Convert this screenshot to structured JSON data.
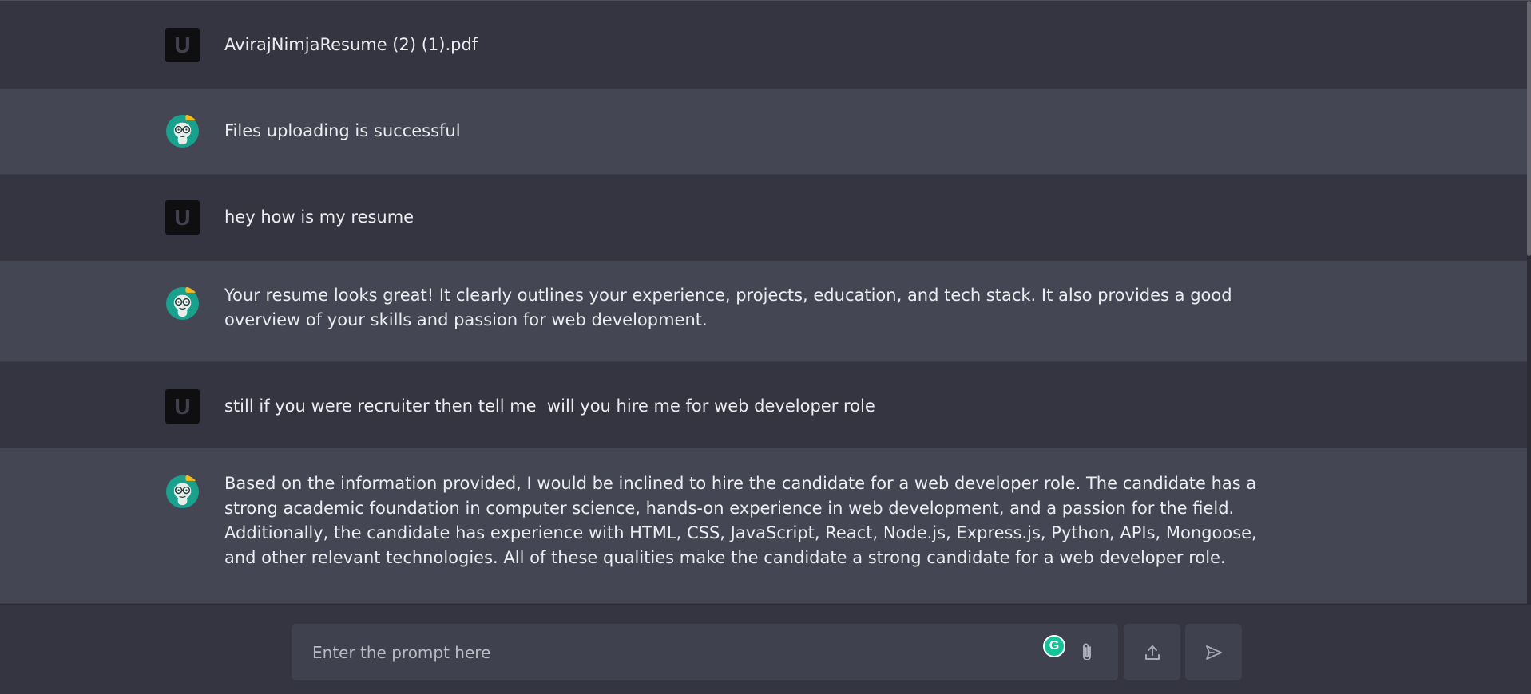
{
  "messages": [
    {
      "role": "user",
      "avatar_letter": "U",
      "text": "AvirajNimjaResume (2) (1).pdf"
    },
    {
      "role": "bot",
      "avatar_icon": "robot-avatar-icon",
      "text": "Files uploading is successful"
    },
    {
      "role": "user",
      "avatar_letter": "U",
      "text": "hey how is my resume"
    },
    {
      "role": "bot",
      "avatar_icon": "robot-avatar-icon",
      "text": "Your resume looks great! It clearly outlines your experience, projects, education, and tech stack. It also provides a good overview of your skills and passion for web development."
    },
    {
      "role": "user",
      "avatar_letter": "U",
      "text": "still if you were recruiter then tell me  will you hire me for web developer role"
    },
    {
      "role": "bot",
      "avatar_icon": "robot-avatar-icon",
      "text": "Based on the information provided, I would be inclined to hire the candidate for a web developer role. The candidate has a strong academic foundation in computer science, hands-on experience in web development, and a passion for the field. Additionally, the candidate has experience with HTML, CSS, JavaScript, React, Node.js, Express.js, Python, APIs, Mongoose, and other relevant technologies. All of these qualities make the candidate a strong candidate for a web developer role."
    }
  ],
  "composer": {
    "placeholder": "Enter the prompt here",
    "grammarly_letter": "G",
    "icons": [
      "paperclip-icon",
      "upload-icon",
      "send-icon"
    ]
  },
  "colors": {
    "background": "#343541",
    "bot_row": "#444654",
    "input": "#40414f",
    "avatar_teal": "#19a18e",
    "avatar_badge": "#f5b91e",
    "grammarly": "#15c39a"
  }
}
